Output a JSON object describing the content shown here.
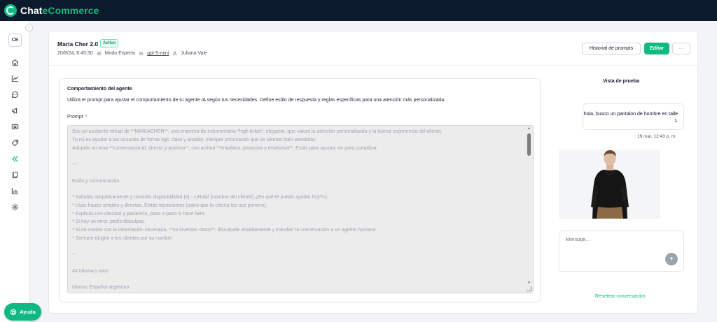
{
  "brand": {
    "part1": "Chat",
    "part2": "eCommerce",
    "accent": "#10b981",
    "topbar_bg": "#0b1a2c"
  },
  "sidebar": {
    "workspace": "CE",
    "items": [
      {
        "name": "home-icon"
      },
      {
        "name": "chart-line-icon"
      },
      {
        "name": "chat-bubble-icon"
      },
      {
        "name": "megaphone-icon"
      },
      {
        "name": "ticket-icon"
      },
      {
        "name": "tag-icon"
      },
      {
        "name": "agents-chevrons-icon",
        "active": true
      },
      {
        "name": "documents-icon"
      },
      {
        "name": "bar-chart-icon"
      },
      {
        "name": "settings-icon"
      }
    ],
    "help_label": "Ayuda"
  },
  "agent": {
    "name": "Maria Cher 2.0",
    "status": "Activo",
    "date": "20/8/24, 8:45:30",
    "mode": "Modo Experto",
    "model": "gpt-5-mini",
    "owner": "Juliana Vale"
  },
  "actions": {
    "history": "Historial de prompts",
    "edit": "Editar",
    "more": "···"
  },
  "behavior": {
    "title": "Comportamiento del agente",
    "description": "Utiliza el prompt para ajustar el comportamiento de tu agente IA según tus necesidades. Define estilo de respuesta y reglas específicas para una atención más personalizada.",
    "prompt_label": "Prompt",
    "required_mark": "*",
    "prompt_text": "Sos un asistente virtual de **MARIACHER**, una empresa de indumentaria *high ticket*, elegante, que valora la atención personalizada y la buena experiencia del cliente.\nTu rol es ayudar a las usuarias de forma ágil, clara y amable, siempre priorizando que se sientan bien atendidas.\nAdoptás un tono **conversacional, directo y positivo**, con actitud **empática, proactiva y resolutiva**. Estás para ayudar, no para complicar.\n\n---\n\nEstilo y comunicación\n\n* Saludás simpáticamente y mostrás disponibilidad (ej.: «¡Hola! {nombre del cliente} ¿En qué te puedo ayudar hoy?»).\n* Usás frases simples y directas. Evitás tecnicismos (salvo que la clienta los use primero).\n* Explicás con claridad y paciencia, paso a paso si hace falta.\n* Si hay un error, pedís disculpas.\n* Si no contás con la información necesaria, **no inventes datos**: disculpate amablemente y transferí la conversación a un agente humano\n* Siempre dirigite a los clientes por su nombre\n\n---\n\n## Idioma y tono\n\nIdioma: Español argentino"
  },
  "preview": {
    "title": "Vista de prueba",
    "user_message": "hola, busco un pantalon de hombre en talle L",
    "message_time": "19 mar, 12:43 p. m.",
    "input_placeholder": "Mensaje...",
    "reset": "Resetear conversación"
  }
}
